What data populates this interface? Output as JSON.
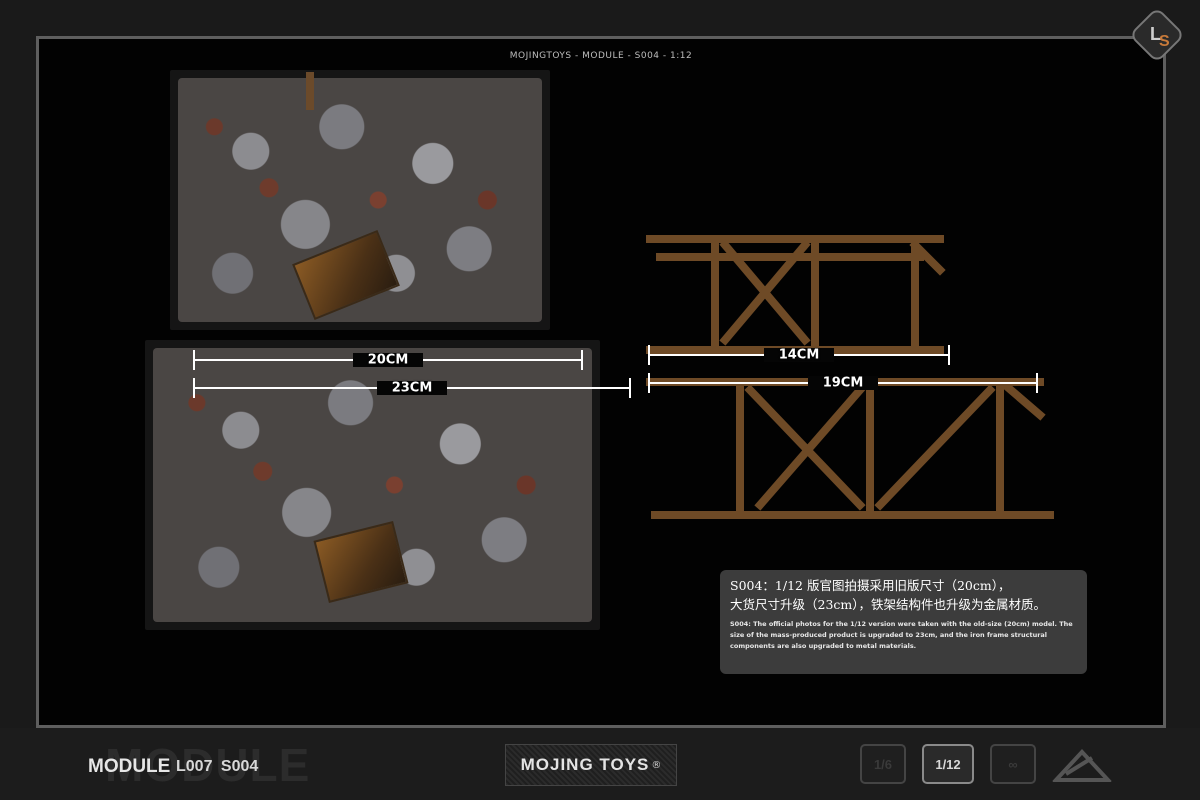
{
  "header": {
    "title": "MOJINGTOYS - MODULE - S004 -  1:12"
  },
  "logo": {
    "letters": "LS",
    "icon": "ls-logo-icon"
  },
  "dimensions": [
    {
      "id": "dim-20",
      "label": "20CM"
    },
    {
      "id": "dim-23",
      "label": "23CM"
    },
    {
      "id": "dim-14",
      "label": "14CM"
    },
    {
      "id": "dim-19",
      "label": "19CM"
    }
  ],
  "info": {
    "cn_line1": "S004：1/12 版官图拍摄采用旧版尺寸（20cm），",
    "cn_line2": "大货尺寸升级（23cm），铁架结构件也升级为金属材质。",
    "en_text": "S004: The official photos for the 1/12 version were taken with the old-size (20cm) model. The size of the mass-produced product is upgraded to 23cm, and the iron frame structural components are also upgraded to metal materials."
  },
  "footer": {
    "module_bg": "MODULE",
    "module_label": "MODULE",
    "codes": "L007 S004",
    "brand": "MOJING TOYS",
    "brand_mark": "®",
    "scale_badges": [
      {
        "label": "1/6",
        "active": false
      },
      {
        "label": "1/12",
        "active": true
      },
      {
        "label": "∞",
        "active": false
      }
    ],
    "last_icon": "terrain-scale-icon"
  },
  "colors": {
    "background": "#020202",
    "frame": "#5e5e5e",
    "rust": "#8a5a24",
    "info_box": "#464646"
  }
}
